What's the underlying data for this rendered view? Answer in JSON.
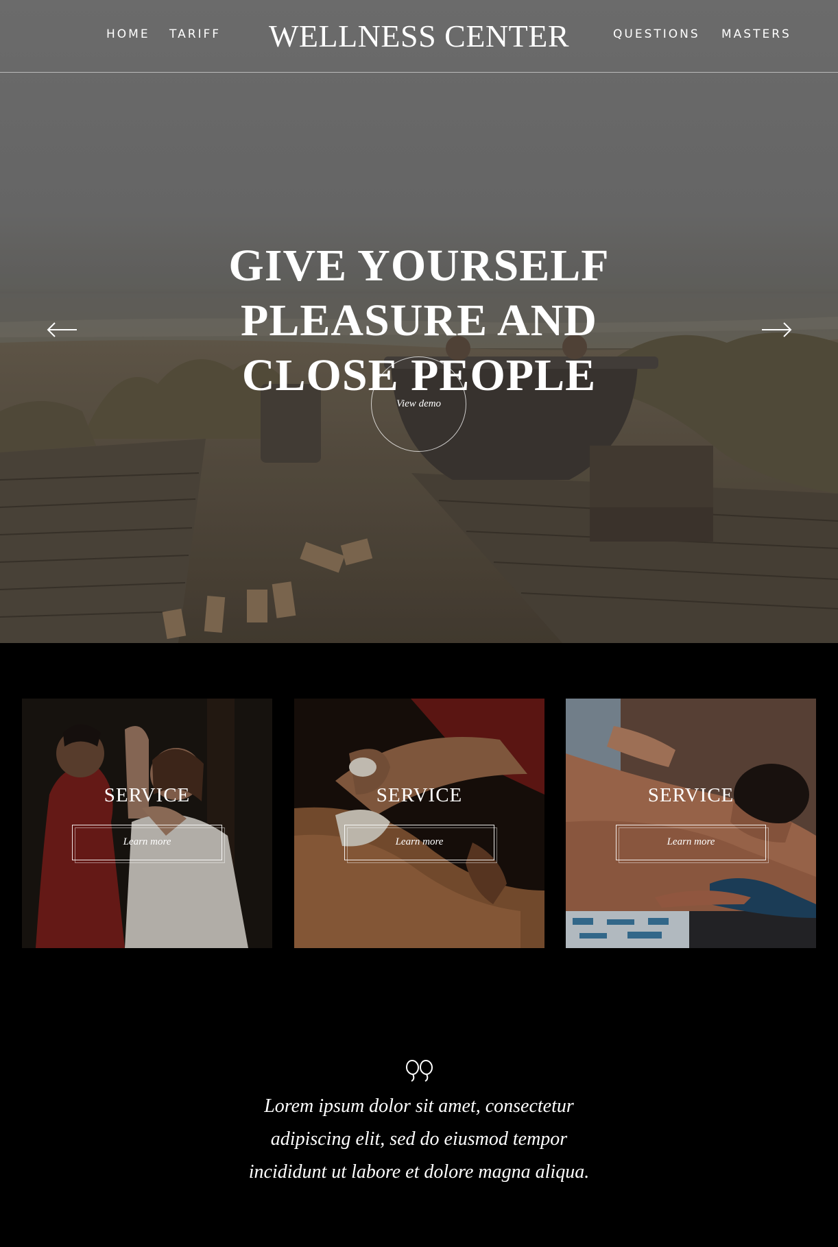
{
  "nav": {
    "brand": "WELLNESS CENTER",
    "left_links": [
      "HOME",
      "TARIFF"
    ],
    "right_links": [
      "QUESTIONS",
      "MASTERS"
    ]
  },
  "hero": {
    "title_lines": [
      "GIVE YOURSELF",
      "PLEASURE AND",
      "CLOSE PEOPLE"
    ],
    "demo_label": "View demo",
    "prev_icon": "arrow-left-icon",
    "next_icon": "arrow-right-icon"
  },
  "services": [
    {
      "title": "SERVICE",
      "button": "Learn more"
    },
    {
      "title": "SERVICE",
      "button": "Learn more"
    },
    {
      "title": "SERVICE",
      "button": "Learn more"
    }
  ],
  "quote": {
    "icon": "quote-icon",
    "lines": [
      "Lorem ipsum dolor sit amet, consectetur",
      "adipiscing elit, sed do eiusmod tempor",
      "incididunt ut labore et dolore magna aliqua."
    ]
  },
  "colors": {
    "page_background": "#000000",
    "text": "#ffffff",
    "header_gray": "#777777"
  }
}
